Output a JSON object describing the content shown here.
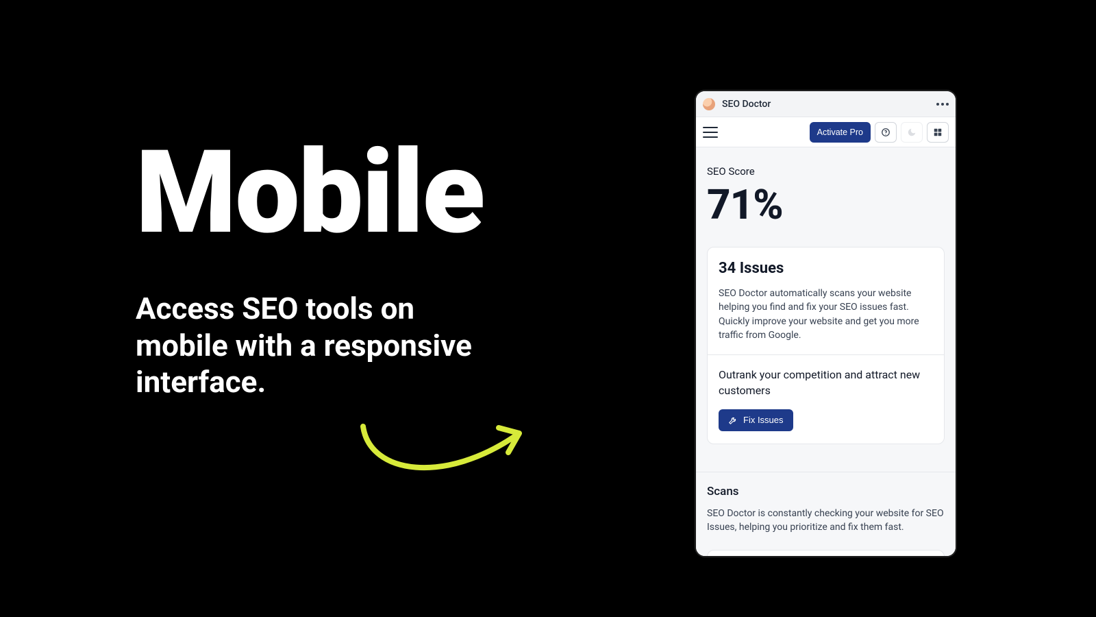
{
  "hero": {
    "title": "Mobile",
    "subtitle": "Access SEO tools on mobile with a responsive interface."
  },
  "mobile_app": {
    "window_title": "SEO Doctor",
    "toolbar": {
      "activate_label": "Activate Pro"
    },
    "score": {
      "label": "SEO Score",
      "value": "71%"
    },
    "issues_card": {
      "title": "34 Issues",
      "body": "SEO Doctor automatically scans your website helping you find and fix your SEO issues fast. Quickly improve your website and get you more traffic from Google.",
      "cta_title": "Outrank your competition and attract new customers",
      "fix_button_label": "Fix Issues"
    },
    "scans": {
      "title": "Scans",
      "body": "SEO Doctor is constantly checking your website for SEO Issues, helping you prioritize and fix them fast."
    }
  }
}
